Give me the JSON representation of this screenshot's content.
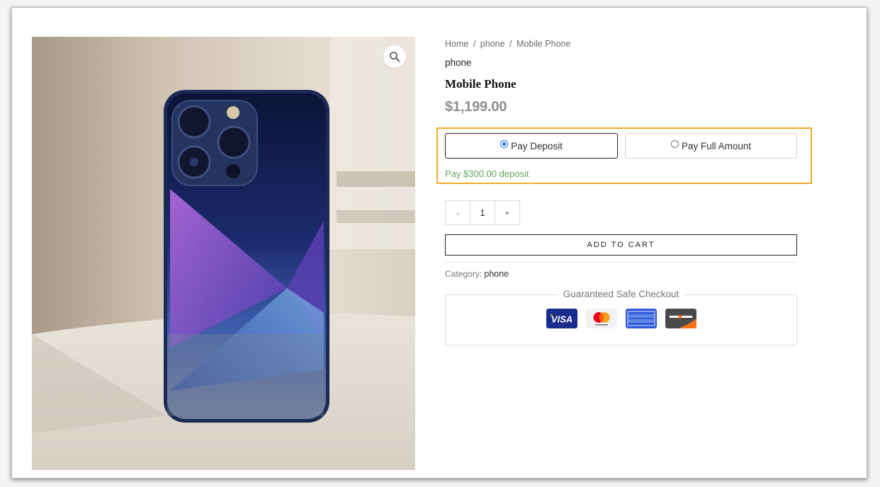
{
  "breadcrumb": {
    "home": "Home",
    "separator": "/",
    "category": "phone",
    "current": "Mobile Phone"
  },
  "product": {
    "category_label": "phone",
    "title": "Mobile Phone",
    "price": "$1,199.00",
    "image_icon": "smartphone-photo",
    "zoom_icon": "magnifier-icon"
  },
  "payment_options": {
    "deposit_label": "Pay Deposit",
    "full_label": "Pay Full Amount",
    "selected": "deposit",
    "deposit_note": "Pay $300.00 deposit"
  },
  "quantity": {
    "minus": "-",
    "value": "1",
    "plus": "+"
  },
  "cart": {
    "add_label": "ADD TO CART"
  },
  "meta": {
    "category_prefix": "Category:",
    "category_value": "phone"
  },
  "checkout": {
    "title": "Guaranteed Safe Checkout",
    "cards": [
      "visa",
      "mastercard",
      "american-express",
      "discover"
    ]
  },
  "colors": {
    "highlight_border": "#f0ab24",
    "deposit_text": "#63a35c",
    "price_text": "#8e8e8e"
  }
}
